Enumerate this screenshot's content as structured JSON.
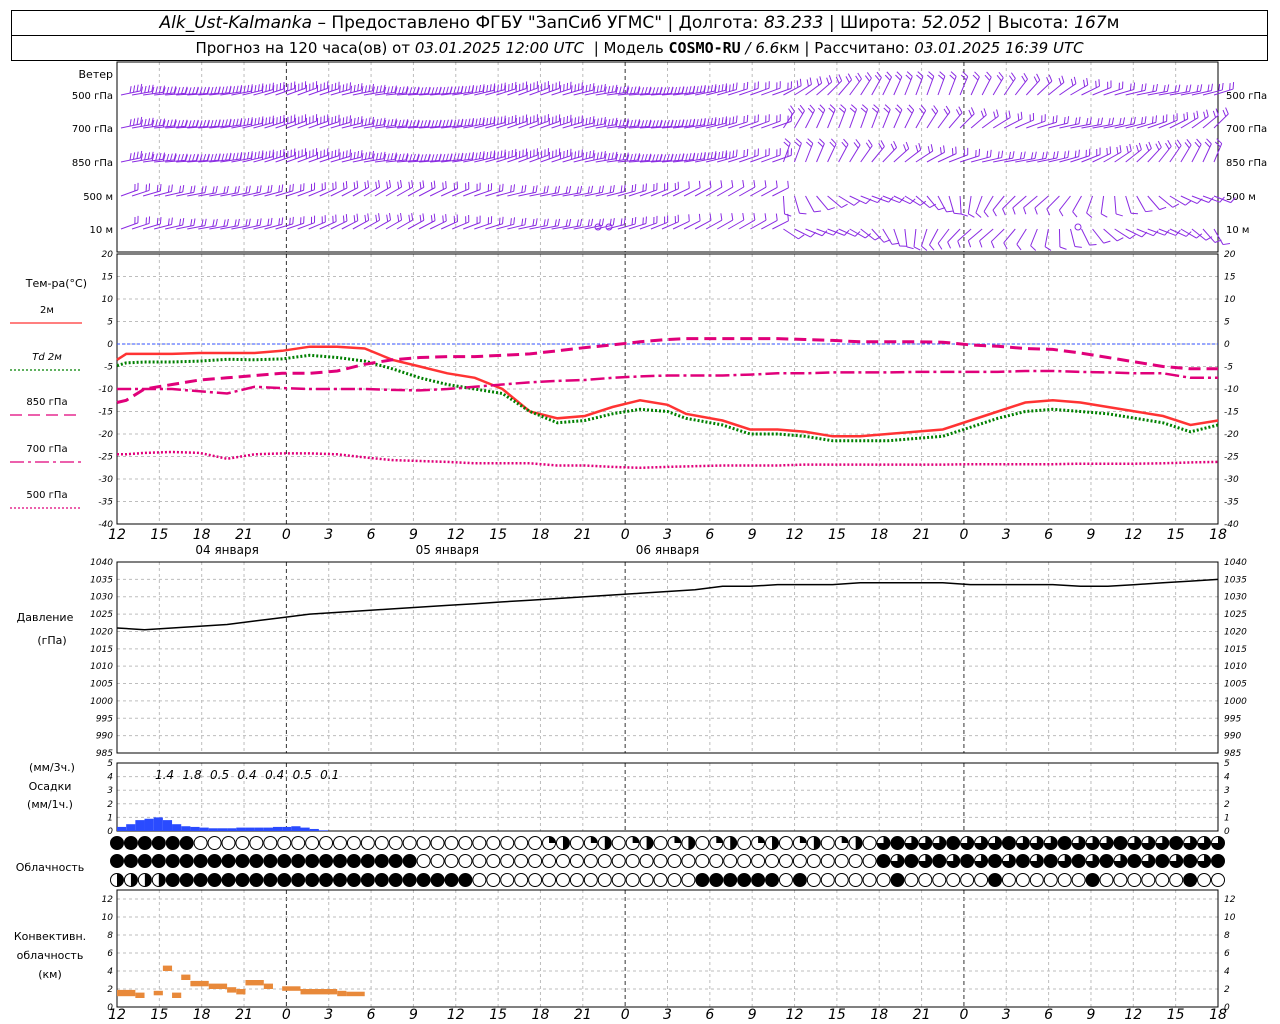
{
  "header": {
    "station": "Alk_Ust-Kalmanka",
    "dash": "–",
    "provider": "Предоставлено ФГБУ \"ЗапСиб УГМС\"",
    "lon_label": "Долгота:",
    "lon_value": "83.233",
    "lat_label": "Широта:",
    "lat_value": "52.052",
    "alt_label": "Высота:",
    "alt_value": "167",
    "alt_unit": "м",
    "sep": "|",
    "forecast_label": "Прогноз на 120 часа(ов) от",
    "forecast_time": "03.01.2025 12:00 UTC",
    "model_label": "Модель",
    "model_name": "COSMO-RU",
    "model_res": "/ 6.6",
    "model_res_unit": "км",
    "calc_label": "Рассчитано:",
    "calc_time": "03.01.2025 16:39 UTC"
  },
  "time_axis": {
    "hour_labels": [
      "12",
      "15",
      "18",
      "21",
      "0",
      "3",
      "6",
      "9",
      "12",
      "15",
      "18",
      "21",
      "0",
      "3",
      "6",
      "9",
      "12",
      "15",
      "18",
      "21",
      "0",
      "3",
      "6",
      "9",
      "12",
      "15",
      "18"
    ],
    "date_labels": [
      {
        "label": "04 января",
        "hour_index": 12
      },
      {
        "label": "05 января",
        "hour_index": 36
      },
      {
        "label": "06 января",
        "hour_index": 60
      }
    ]
  },
  "wind_panel": {
    "title": "Ветер",
    "levels": [
      "500 гПа",
      "700 гПа",
      "850 гПа",
      "500 м",
      "10 м"
    ],
    "color": "#8a2be2"
  },
  "temp_panel": {
    "title": "Тем-ра(°C)",
    "legend": [
      {
        "label": "2м",
        "color": "#ff3333",
        "style": "solid"
      },
      {
        "label": "Td  2м",
        "color": "#008000",
        "style": "dotted"
      },
      {
        "label": "850 гПа",
        "color": "#e0007a",
        "style": "dashed"
      },
      {
        "label": "700 гПа",
        "color": "#e0007a",
        "style": "dashdot"
      },
      {
        "label": "500 гПа",
        "color": "#e0007a",
        "style": "dotted"
      }
    ],
    "y_ticks": [
      "20",
      "15",
      "10",
      "5",
      "0",
      "-5",
      "-10",
      "-15",
      "-20",
      "-25",
      "-30",
      "-35",
      "-40"
    ]
  },
  "pressure_panel": {
    "title": "Давление",
    "unit": "(гПа)",
    "y_ticks": [
      "1040",
      "1035",
      "1030",
      "1025",
      "1020",
      "1015",
      "1010",
      "1005",
      "1000",
      "995",
      "990",
      "985"
    ]
  },
  "precip_panel": {
    "unit_top": "(мм/3ч.)",
    "title": "Осадки",
    "unit_bottom": "(мм/1ч.)",
    "y_ticks": [
      "5",
      "4",
      "3",
      "2",
      "1",
      "0"
    ],
    "sum_labels": [
      {
        "hour": 3,
        "value": "1.4"
      },
      {
        "hour": 6,
        "value": "1.8"
      },
      {
        "hour": 9,
        "value": "0.5"
      },
      {
        "hour": 12,
        "value": "0.4"
      },
      {
        "hour": 15,
        "value": "0.4"
      },
      {
        "hour": 18,
        "value": "0.5"
      },
      {
        "hour": 21,
        "value": "0.1"
      }
    ]
  },
  "cloud_panel": {
    "title": "Облачность"
  },
  "conv_panel": {
    "title_lines": [
      "Конвективн.",
      "облачность",
      "(км)"
    ],
    "y_ticks": [
      "12",
      "10",
      "8",
      "6",
      "4",
      "2",
      "0"
    ],
    "color": "#e8893a"
  },
  "chart_data": [
    {
      "type": "line",
      "title": "Тем-ра(°C)",
      "x_hours_from_start": [
        0,
        1,
        3,
        6,
        9,
        12,
        15,
        18,
        21,
        24,
        27,
        30,
        33,
        36,
        39,
        42,
        45,
        48,
        51,
        54,
        57,
        60,
        62,
        66,
        69,
        72,
        75,
        78,
        81,
        84,
        87,
        90,
        93,
        96,
        99,
        102,
        105,
        108,
        111,
        114,
        117,
        120
      ],
      "series": [
        {
          "name": "2м",
          "values": [
            -3.5,
            -2.2,
            -2.2,
            -2.2,
            -2.0,
            -2.0,
            -2.0,
            -1.5,
            -0.6,
            -0.6,
            -1.0,
            -3.5,
            -5.0,
            -6.5,
            -7.5,
            -10,
            -15,
            -16.5,
            -16,
            -14,
            -12.5,
            -13.5,
            -15.5,
            -17,
            -19,
            -19,
            -19.5,
            -20.5,
            -20.5,
            -20,
            -19.5,
            -19,
            -17,
            -15,
            -13,
            -12.5,
            -13,
            -14,
            -15,
            -16,
            -18,
            -17
          ]
        },
        {
          "name": "Td  2м",
          "values": [
            -4.8,
            -4.2,
            -4.0,
            -4.0,
            -3.8,
            -3.4,
            -3.5,
            -3.3,
            -2.5,
            -3.0,
            -3.8,
            -5.5,
            -7.5,
            -9,
            -10,
            -11,
            -15,
            -17.5,
            -17,
            -15.5,
            -14.5,
            -15,
            -16.5,
            -18,
            -20,
            -20,
            -20.5,
            -21.5,
            -21.5,
            -21.5,
            -21,
            -20.5,
            -18.5,
            -16.5,
            -15,
            -14.5,
            -15,
            -15.5,
            -16.5,
            -17.5,
            -19.5,
            -18
          ]
        },
        {
          "name": "850 гПа",
          "values": [
            -13,
            -12.5,
            -10,
            -9,
            -8,
            -7.5,
            -7,
            -6.5,
            -6.5,
            -6,
            -4.5,
            -3.5,
            -3,
            -2.8,
            -2.8,
            -2.5,
            -2.2,
            -1.5,
            -0.8,
            -0.2,
            0.5,
            1.0,
            1.2,
            1.2,
            1.2,
            1.2,
            1.0,
            0.8,
            0.5,
            0.5,
            0.5,
            0.4,
            -0.2,
            -0.5,
            -1.0,
            -1.2,
            -2,
            -3,
            -4,
            -5,
            -5.5,
            -5.5
          ]
        },
        {
          "name": "700 гПа",
          "values": [
            -10,
            -10,
            -10,
            -10,
            -10.5,
            -11,
            -9.5,
            -9.8,
            -10,
            -10,
            -10,
            -10.2,
            -10.3,
            -10,
            -9.5,
            -9,
            -8.5,
            -8.2,
            -8,
            -7.5,
            -7.2,
            -7,
            -7,
            -7,
            -6.8,
            -6.5,
            -6.5,
            -6.3,
            -6.3,
            -6.3,
            -6.2,
            -6.2,
            -6.2,
            -6.2,
            -6.0,
            -6.0,
            -6.2,
            -6.3,
            -6.5,
            -6.5,
            -7.5,
            -7.5
          ]
        },
        {
          "name": "500 гПа",
          "values": [
            -24.5,
            -24.5,
            -24.2,
            -24.0,
            -24.2,
            -25.5,
            -24.5,
            -24.3,
            -24.3,
            -24.5,
            -25.2,
            -25.8,
            -26,
            -26.2,
            -26.5,
            -26.5,
            -26.5,
            -27,
            -27,
            -27.3,
            -27.5,
            -27.3,
            -27.2,
            -27,
            -27,
            -27,
            -26.8,
            -26.8,
            -26.8,
            -26.8,
            -26.8,
            -26.8,
            -26.7,
            -26.7,
            -26.7,
            -26.7,
            -26.6,
            -26.6,
            -26.6,
            -26.5,
            -26.3,
            -26.2
          ]
        }
      ],
      "ylim": [
        -40,
        20
      ]
    },
    {
      "type": "line",
      "title": "Давление",
      "ylabel": "(гПа)",
      "x_hours_from_start": [
        0,
        3,
        6,
        9,
        12,
        15,
        18,
        21,
        24,
        27,
        30,
        33,
        36,
        39,
        42,
        45,
        48,
        51,
        54,
        57,
        60,
        63,
        66,
        69,
        72,
        75,
        78,
        81,
        84,
        87,
        90,
        93,
        96,
        99,
        102,
        105,
        108,
        111,
        114,
        117,
        120
      ],
      "series": [
        {
          "name": "Давление",
          "values": [
            1021,
            1020.5,
            1021,
            1021.5,
            1022,
            1023,
            1024,
            1025,
            1025.5,
            1026,
            1026.5,
            1027,
            1027.5,
            1028,
            1028.5,
            1029,
            1029.5,
            1030,
            1030.5,
            1031,
            1031.5,
            1032,
            1033,
            1033,
            1033.5,
            1033.5,
            1033.5,
            1034,
            1034,
            1034,
            1034,
            1033.5,
            1033.5,
            1033.5,
            1033.5,
            1033,
            1033,
            1033.5,
            1034,
            1034.5,
            1035
          ]
        }
      ],
      "ylim": [
        985,
        1040
      ]
    },
    {
      "type": "bar",
      "title": "Осадки",
      "x_hours_from_start": [
        0,
        1,
        2,
        3,
        4,
        5,
        6,
        7,
        8,
        9,
        10,
        11,
        12,
        13,
        14,
        15,
        16,
        17,
        18,
        19,
        20,
        21,
        22
      ],
      "values": [
        0.3,
        0.5,
        0.8,
        0.9,
        1.0,
        0.8,
        0.5,
        0.35,
        0.3,
        0.25,
        0.2,
        0.2,
        0.2,
        0.25,
        0.25,
        0.25,
        0.25,
        0.3,
        0.3,
        0.35,
        0.25,
        0.15,
        0.05
      ],
      "ylim": [
        0,
        5
      ],
      "color": "#2a4bff"
    },
    {
      "type": "bar",
      "title": "Конвективн. облачность (км)",
      "segments": [
        {
          "start": 0,
          "end": 2,
          "base": 1.2,
          "top": 1.9
        },
        {
          "start": 2,
          "end": 3,
          "base": 1.0,
          "top": 1.6
        },
        {
          "start": 4,
          "end": 5,
          "base": 1.3,
          "top": 1.8
        },
        {
          "start": 5,
          "end": 6,
          "base": 4.0,
          "top": 4.6
        },
        {
          "start": 6,
          "end": 7,
          "base": 1.0,
          "top": 1.6
        },
        {
          "start": 7,
          "end": 8,
          "base": 3.0,
          "top": 3.6
        },
        {
          "start": 8,
          "end": 10,
          "base": 2.3,
          "top": 2.9
        },
        {
          "start": 10,
          "end": 12,
          "base": 2.0,
          "top": 2.6
        },
        {
          "start": 12,
          "end": 13,
          "base": 1.6,
          "top": 2.2
        },
        {
          "start": 13,
          "end": 14,
          "base": 1.4,
          "top": 2.0
        },
        {
          "start": 14,
          "end": 16,
          "base": 2.4,
          "top": 3.0
        },
        {
          "start": 16,
          "end": 17,
          "base": 2.0,
          "top": 2.6
        },
        {
          "start": 18,
          "end": 20,
          "base": 1.8,
          "top": 2.3
        },
        {
          "start": 20,
          "end": 24,
          "base": 1.4,
          "top": 2.0
        },
        {
          "start": 24,
          "end": 25,
          "base": 1.2,
          "top": 1.8
        },
        {
          "start": 25,
          "end": 27,
          "base": 1.2,
          "top": 1.7
        }
      ],
      "ylim": [
        0,
        13
      ]
    }
  ]
}
